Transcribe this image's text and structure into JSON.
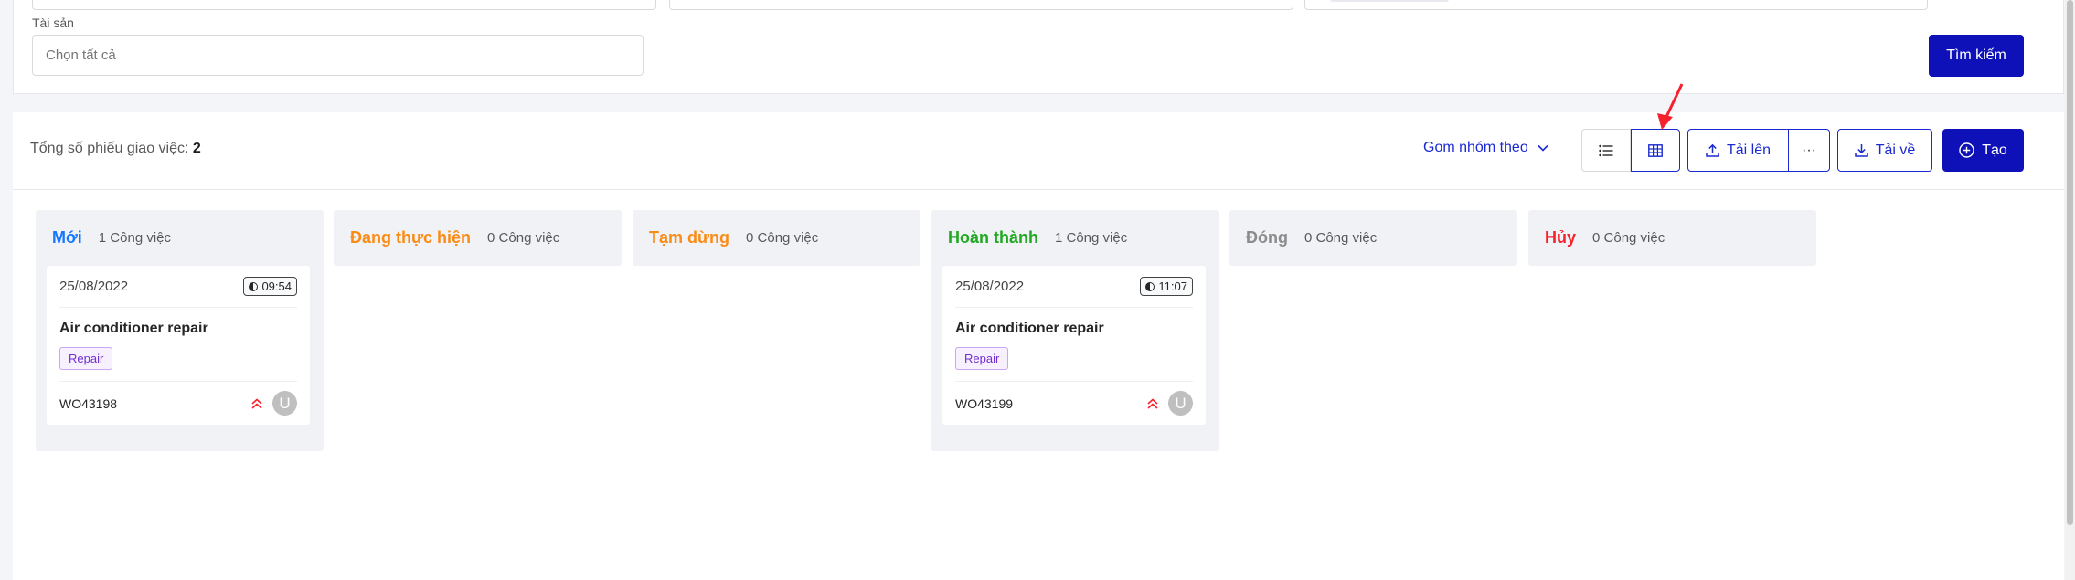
{
  "filters": {
    "asset_label": "Tài sản",
    "asset_placeholder": "Chọn tất cả",
    "search_label": "Tìm kiếm"
  },
  "toolbar": {
    "total_label": "Tổng số phiếu giao việc:",
    "total_count": "2",
    "group_by_label": "Gom nhóm theo",
    "upload_label": "Tải lên",
    "more_label": "···",
    "download_label": "Tải về",
    "create_label": "Tạo"
  },
  "colors": {
    "primary": "#0e11b8",
    "new": "#1677ff",
    "in_progress": "#fa8c16",
    "paused": "#fa8c16",
    "done": "#22a822",
    "closed": "#8c8c8c",
    "cancelled": "#f5222d",
    "arrow": "#f5222d"
  },
  "columns": [
    {
      "title": "Mới",
      "count": "1 Công việc",
      "cards": [
        {
          "date": "25/08/2022",
          "time": "09:54",
          "title": "Air conditioner repair",
          "tag": "Repair",
          "code": "WO43198",
          "avatar": "U"
        }
      ]
    },
    {
      "title": "Đang thực hiện",
      "count": "0 Công việc",
      "cards": []
    },
    {
      "title": "Tạm dừng",
      "count": "0 Công việc",
      "cards": []
    },
    {
      "title": "Hoàn thành",
      "count": "1 Công việc",
      "cards": [
        {
          "date": "25/08/2022",
          "time": "11:07",
          "title": "Air conditioner repair",
          "tag": "Repair",
          "code": "WO43199",
          "avatar": "U"
        }
      ]
    },
    {
      "title": "Đóng",
      "count": "0 Công việc",
      "cards": []
    },
    {
      "title": "Hủy",
      "count": "0 Công việc",
      "cards": []
    }
  ]
}
